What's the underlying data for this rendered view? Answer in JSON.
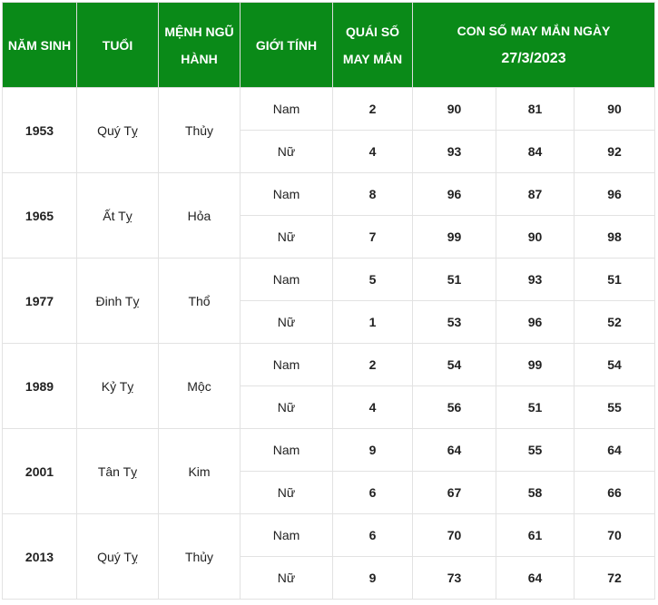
{
  "header": {
    "birth_year": "NĂM SINH",
    "age": "TUỔI",
    "element_line1": "MỆNH NGŨ",
    "element_line2": "HÀNH",
    "gender": "GIỚI TÍNH",
    "quai_line1": "QUÁI SỐ",
    "quai_line2": "MAY MẮN",
    "lucky_line1": "CON SỐ MAY MẮN NGÀY",
    "lucky_date": "27/3/2023"
  },
  "rows": [
    {
      "year": "1953",
      "age": "Quý Tỵ",
      "element": "Thủy",
      "entries": [
        {
          "gender": "Nam",
          "quai": "2",
          "numbers": [
            "90",
            "81",
            "90"
          ]
        },
        {
          "gender": "Nữ",
          "quai": "4",
          "numbers": [
            "93",
            "84",
            "92"
          ]
        }
      ]
    },
    {
      "year": "1965",
      "age": "Ất Tỵ",
      "element": "Hỏa",
      "entries": [
        {
          "gender": "Nam",
          "quai": "8",
          "numbers": [
            "96",
            "87",
            "96"
          ]
        },
        {
          "gender": "Nữ",
          "quai": "7",
          "numbers": [
            "99",
            "90",
            "98"
          ]
        }
      ]
    },
    {
      "year": "1977",
      "age": "Đinh Tỵ",
      "element": "Thổ",
      "entries": [
        {
          "gender": "Nam",
          "quai": "5",
          "numbers": [
            "51",
            "93",
            "51"
          ]
        },
        {
          "gender": "Nữ",
          "quai": "1",
          "numbers": [
            "53",
            "96",
            "52"
          ]
        }
      ]
    },
    {
      "year": "1989",
      "age": "Kỷ Tỵ",
      "element": "Mộc",
      "entries": [
        {
          "gender": "Nam",
          "quai": "2",
          "numbers": [
            "54",
            "99",
            "54"
          ]
        },
        {
          "gender": "Nữ",
          "quai": "4",
          "numbers": [
            "56",
            "51",
            "55"
          ]
        }
      ]
    },
    {
      "year": "2001",
      "age": "Tân Tỵ",
      "element": "Kim",
      "entries": [
        {
          "gender": "Nam",
          "quai": "9",
          "numbers": [
            "64",
            "55",
            "64"
          ]
        },
        {
          "gender": "Nữ",
          "quai": "6",
          "numbers": [
            "67",
            "58",
            "66"
          ]
        }
      ]
    },
    {
      "year": "2013",
      "age": "Quý Tỵ",
      "element": "Thủy",
      "entries": [
        {
          "gender": "Nam",
          "quai": "6",
          "numbers": [
            "70",
            "61",
            "70"
          ]
        },
        {
          "gender": "Nữ",
          "quai": "9",
          "numbers": [
            "73",
            "64",
            "72"
          ]
        }
      ]
    }
  ],
  "colors": {
    "header_bg": "#0a8a18",
    "header_text": "#ffffff",
    "quai_number": "#e00000"
  }
}
